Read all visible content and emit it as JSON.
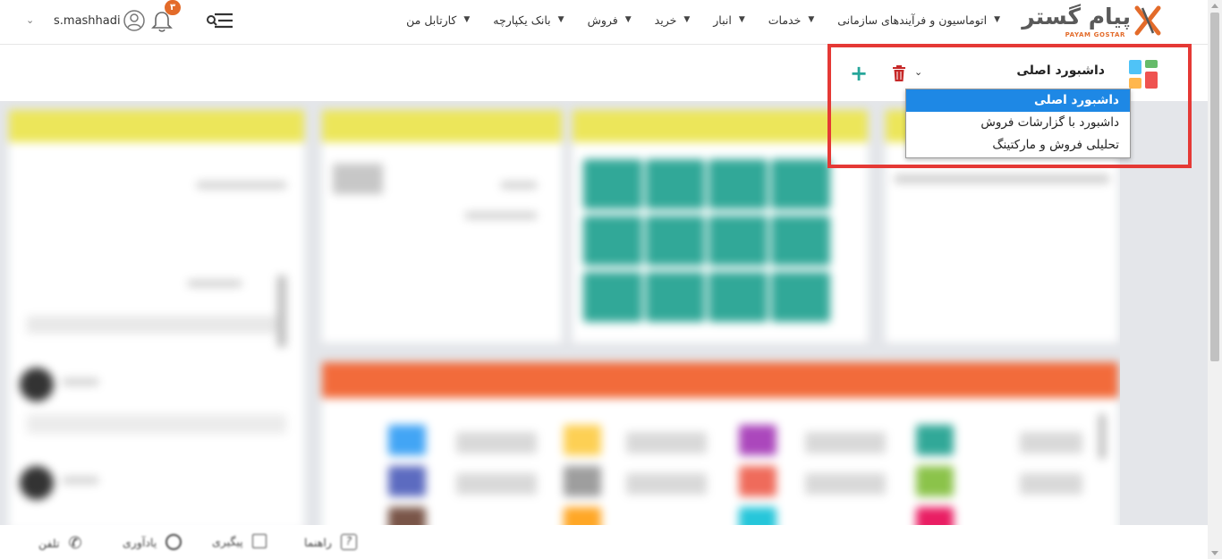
{
  "app": {
    "logo_fa": "پیام گستر",
    "logo_en": "PAYAM GOSTAR",
    "brand_color": "#e36b2a"
  },
  "nav": {
    "items": [
      {
        "label": "کارتابل من",
        "icon": "chevron-down-icon"
      },
      {
        "label": "بانک یکپارچه",
        "icon": "chevron-down-icon"
      },
      {
        "label": "فروش",
        "icon": "chevron-down-icon"
      },
      {
        "label": "خرید",
        "icon": "chevron-down-icon"
      },
      {
        "label": "انبار",
        "icon": "chevron-down-icon"
      },
      {
        "label": "خدمات",
        "icon": "chevron-down-icon"
      },
      {
        "label": "اتوماسیون و فرآیندهای سازمانی",
        "icon": "chevron-down-icon"
      }
    ],
    "notification_count": "۳",
    "username": "s.mashhadi"
  },
  "dashboard": {
    "selected": "داشبورد اصلی",
    "options": [
      {
        "label": "داشبورد اصلی",
        "active": true
      },
      {
        "label": "داشبورد با گزارشات فروش",
        "active": false
      },
      {
        "label": "تحلیلی فروش و مارکتینگ",
        "active": false
      }
    ],
    "add_color": "#26a69a",
    "delete_color": "#c62828",
    "highlight_color": "#e53935"
  },
  "panels": {
    "header_color": "#ece65a",
    "wide_header_color": "#f26b3b",
    "tile_color": "#31a898"
  },
  "bottombar": {
    "items": [
      {
        "label": "راهنما",
        "icon": "help-icon"
      },
      {
        "label": "پیگیری",
        "icon": "list-icon"
      },
      {
        "label": "یادآوری",
        "icon": "clock-icon"
      },
      {
        "label": "تلفن",
        "icon": "phone-icon"
      }
    ]
  }
}
